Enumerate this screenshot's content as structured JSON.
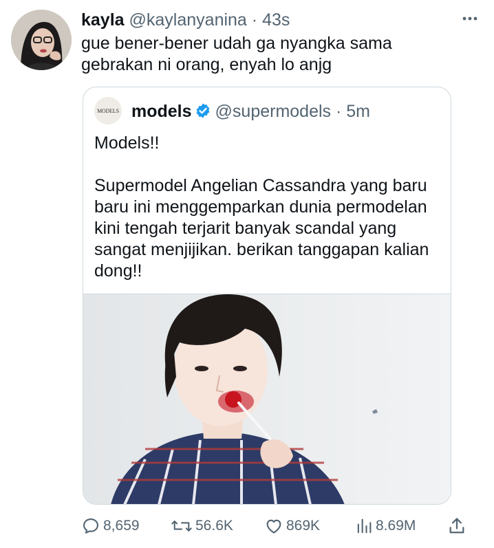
{
  "tweet": {
    "name": "kayla",
    "handle": "@kaylanyanina",
    "separator": " · ",
    "time": "43s",
    "text": "gue bener-bener udah ga nyangka sama gebrakan ni orang, enyah lo anjg",
    "more_icon": "more-horizontal-icon"
  },
  "quote": {
    "avatar_text": "MODELS",
    "name": "models",
    "handle": "@supermodels",
    "separator": " · ",
    "time": "5m",
    "text_line1": "Models!!",
    "text_body": "Supermodel Angelian Cassandra yang baru baru ini menggemparkan dunia permodelan kini tengah terjarit banyak scandal yang sangat menjijikan. berikan tanggapan kalian dong!!",
    "verified_icon": "verified-badge-icon"
  },
  "actions": {
    "replies": "8,659",
    "retweets": "56.6K",
    "likes": "869K",
    "views": "8.69M"
  },
  "colors": {
    "text": "#0f1419",
    "muted": "#536471",
    "border": "#cfd9de",
    "verified": "#1d9bf0"
  }
}
